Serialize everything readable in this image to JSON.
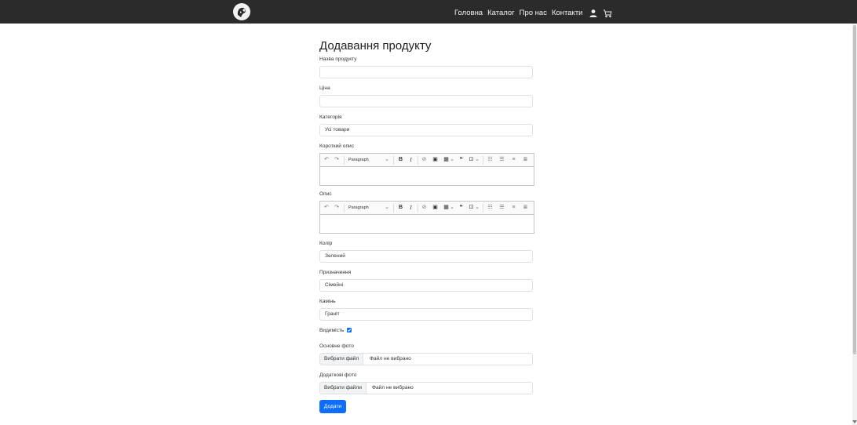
{
  "nav": {
    "links": [
      "Головна",
      "Каталог",
      "Про нас",
      "Контакти"
    ],
    "icons": [
      "user-icon",
      "cart-icon"
    ]
  },
  "form": {
    "title": "Додавання продукту",
    "product_name": {
      "label": "Назва продукту",
      "value": ""
    },
    "price": {
      "label": "Ціна",
      "value": ""
    },
    "category": {
      "label": "Категорія",
      "value": "Усі товари"
    },
    "short_description": {
      "label": "Короткий опис",
      "heading_select": "Paragraph"
    },
    "description": {
      "label": "Опис",
      "heading_select": "Paragraph"
    },
    "color": {
      "label": "Колір",
      "value": "Зелений"
    },
    "purpose": {
      "label": "Призначення",
      "value": "Сімейні"
    },
    "stone": {
      "label": "Камінь",
      "value": "Граніт"
    },
    "visibility": {
      "label": "Видимість",
      "checked": true
    },
    "main_photo": {
      "label": "Основне фото",
      "button": "Вибрати файл",
      "status": "Файл не вибрано"
    },
    "extra_photos": {
      "label": "Додаткові фото",
      "button": "Вибрати файли",
      "status": "Файл не вибрано"
    },
    "submit": "Додати"
  },
  "colors": {
    "navbar": "#2b2b2b",
    "primary": "#0d6efd"
  }
}
